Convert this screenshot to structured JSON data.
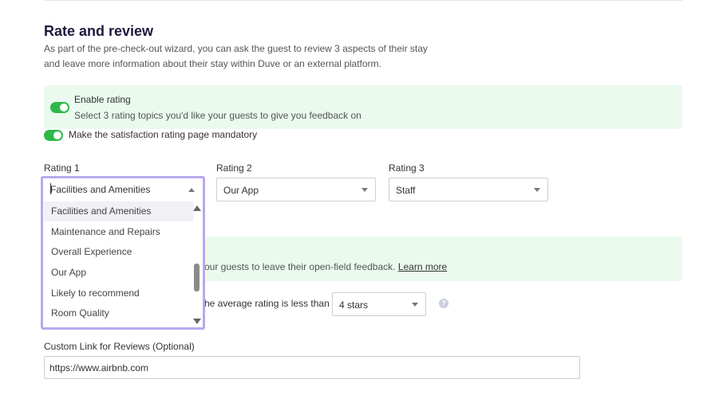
{
  "section": {
    "title": "Rate and review",
    "description_line1": "As part of the pre-check-out wizard, you can ask the guest to review 3 aspects of their stay",
    "description_line2": "and leave more information about their stay within Duve or an external platform."
  },
  "enable_rating": {
    "label": "Enable rating",
    "sublabel": "Select 3 rating topics you'd like your guests to give you feedback on",
    "enabled": true
  },
  "mandatory": {
    "label": "Make the satisfaction rating page mandatory",
    "enabled": true
  },
  "ratings": [
    {
      "label": "Rating 1",
      "value": "Facilities and Amenities"
    },
    {
      "label": "Rating 2",
      "value": "Our App"
    },
    {
      "label": "Rating 3",
      "value": "Staff"
    }
  ],
  "dropdown": {
    "options": [
      "Facilities and Amenities",
      "Maintenance and Repairs",
      "Overall Experience",
      "Our App",
      "Likely to recommend",
      "Room Quality"
    ],
    "highlighted": "Facilities and Amenities"
  },
  "feedback_box": {
    "text_partial": "our guests to leave their open-field feedback.",
    "link": "Learn more"
  },
  "threshold": {
    "text_partial": "he average rating is less than",
    "value": "4 stars",
    "help_icon": "question-icon",
    "help_glyph": "?"
  },
  "custom_link": {
    "label": "Custom Link for Reviews (Optional)",
    "value": "https://www.airbnb.com"
  },
  "colors": {
    "toggle_on": "#2fb84a",
    "green_box": "#eafaee",
    "focus_ring": "#b9a9ec",
    "title": "#1f1a3d"
  }
}
